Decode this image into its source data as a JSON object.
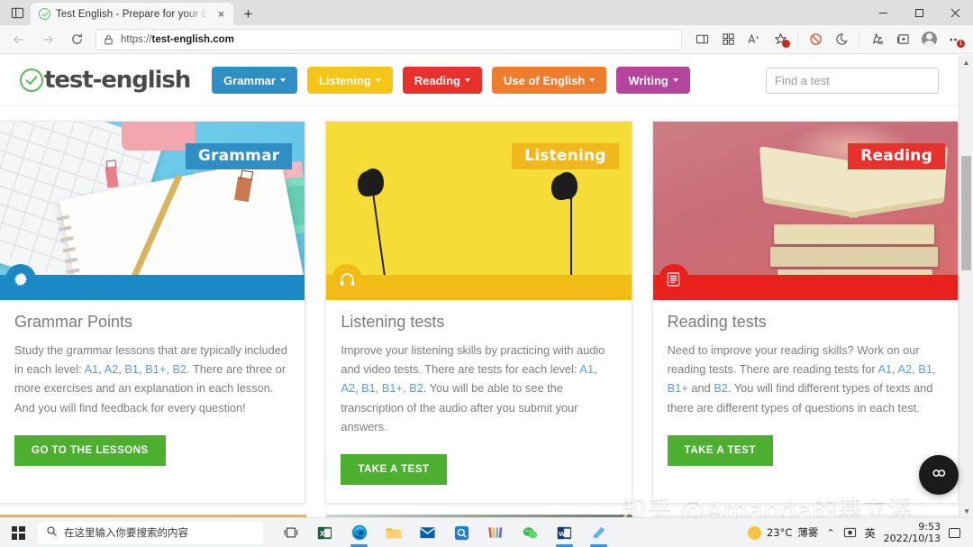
{
  "browser": {
    "tab": {
      "title": "Test English - Prepare for your E",
      "favicon": "check-circle-icon",
      "close_label": "×"
    },
    "new_tab_label": "+",
    "window_controls": {
      "minimize": "−",
      "maximize": "▫",
      "close": "×"
    },
    "nav": {
      "back": "←",
      "forward": "→",
      "reload": "↻"
    },
    "address": {
      "scheme": "https://",
      "host": "test-english.com",
      "lock": "lock-icon"
    },
    "toolbar_icons": [
      "split-screen-icon",
      "collections-grid-icon",
      "read-aloud-icon",
      "favorite-add-icon",
      "shield-blocked-icon",
      "browser-essentials-icon",
      "favorites-list-icon",
      "collections-icon",
      "profile-avatar-icon",
      "settings-more-icon"
    ],
    "more_badge": "1"
  },
  "site": {
    "logo": {
      "text": "test-english",
      "icon": "check-circle-icon",
      "color": "#5cb85c"
    },
    "nav_items": [
      {
        "label": "Grammar",
        "color": "#2f8fc4",
        "caret": true
      },
      {
        "label": "Listening",
        "color": "#f5c518",
        "caret": true
      },
      {
        "label": "Reading",
        "color": "#e8312a",
        "caret": true
      },
      {
        "label": "Use of English",
        "color": "#ef7d2e",
        "caret": true
      },
      {
        "label": "Writing",
        "color": "#b3459c",
        "caret": true
      }
    ],
    "search": {
      "placeholder": "Find a test",
      "value": "",
      "button_icon": "search-icon",
      "button_color": "#4caf2f"
    }
  },
  "cards": [
    {
      "badge": "Grammar",
      "badge_color": "#2f8fc4",
      "bar_color": "#1b8ac4",
      "bar_icon": "gear-icon",
      "title": "Grammar Points",
      "text_before": "Study the grammar lessons that are typically included in each level: ",
      "levels": [
        "A1",
        "A2",
        "B1",
        "B1+",
        "B2"
      ],
      "text_after": ". There are three or more exercises and an explanation in each lesson. And you will find feedback for every question!",
      "cta": "GO TO THE LESSONS"
    },
    {
      "badge": "Listening",
      "badge_color": "#f0b81c",
      "bar_color": "#f2bc17",
      "bar_icon": "headphones-icon",
      "title": "Listening tests",
      "text_before": "Improve your listening skills by practicing with audio and video tests. There are tests for each level: ",
      "levels": [
        "A1",
        "A2",
        "B1",
        "B1+",
        "B2"
      ],
      "text_after": ". You will be able to see the transcription of the audio after you submit your answers.",
      "cta": "TAKE A TEST"
    },
    {
      "badge": "Reading",
      "badge_color": "#e8312a",
      "bar_color": "#e8211d",
      "bar_icon": "document-lines-icon",
      "title": "Reading tests",
      "text_before": "Need to improve your reading skills? Work on our reading tests. There are reading tests for ",
      "levels": [
        "A1",
        "A2",
        "B1",
        "B1+"
      ],
      "text_mid": " and ",
      "levels2": [
        "B2"
      ],
      "text_after": ". You will find different types of texts and there are different types of questions in each test.",
      "cta": "TAKE A TEST"
    }
  ],
  "chat_widget": {
    "icon": "chat-bubble-icon"
  },
  "watermark": "知乎 @Amanda的基立溪",
  "taskbar": {
    "start_icon": "windows-logo-icon",
    "search_placeholder": "在这里输入你要搜索的内容",
    "search_icon": "search-icon",
    "pinned": [
      "task-view-icon",
      "excel-icon",
      "edge-icon",
      "file-explorer-icon",
      "mail-icon",
      "search-app-icon",
      "stripes-app-icon",
      "wechat-icon",
      "word-icon",
      "screenshot-tool-icon"
    ],
    "weather": {
      "temp": "23°C",
      "condition": "薄雾",
      "icon": "sun-icon"
    },
    "tray": {
      "chevron": "⌃",
      "network_icon": "network-icon",
      "ime": "英"
    },
    "clock": {
      "time": "9:53",
      "date": "2022/10/13"
    },
    "notification_icon": "notification-icon"
  }
}
